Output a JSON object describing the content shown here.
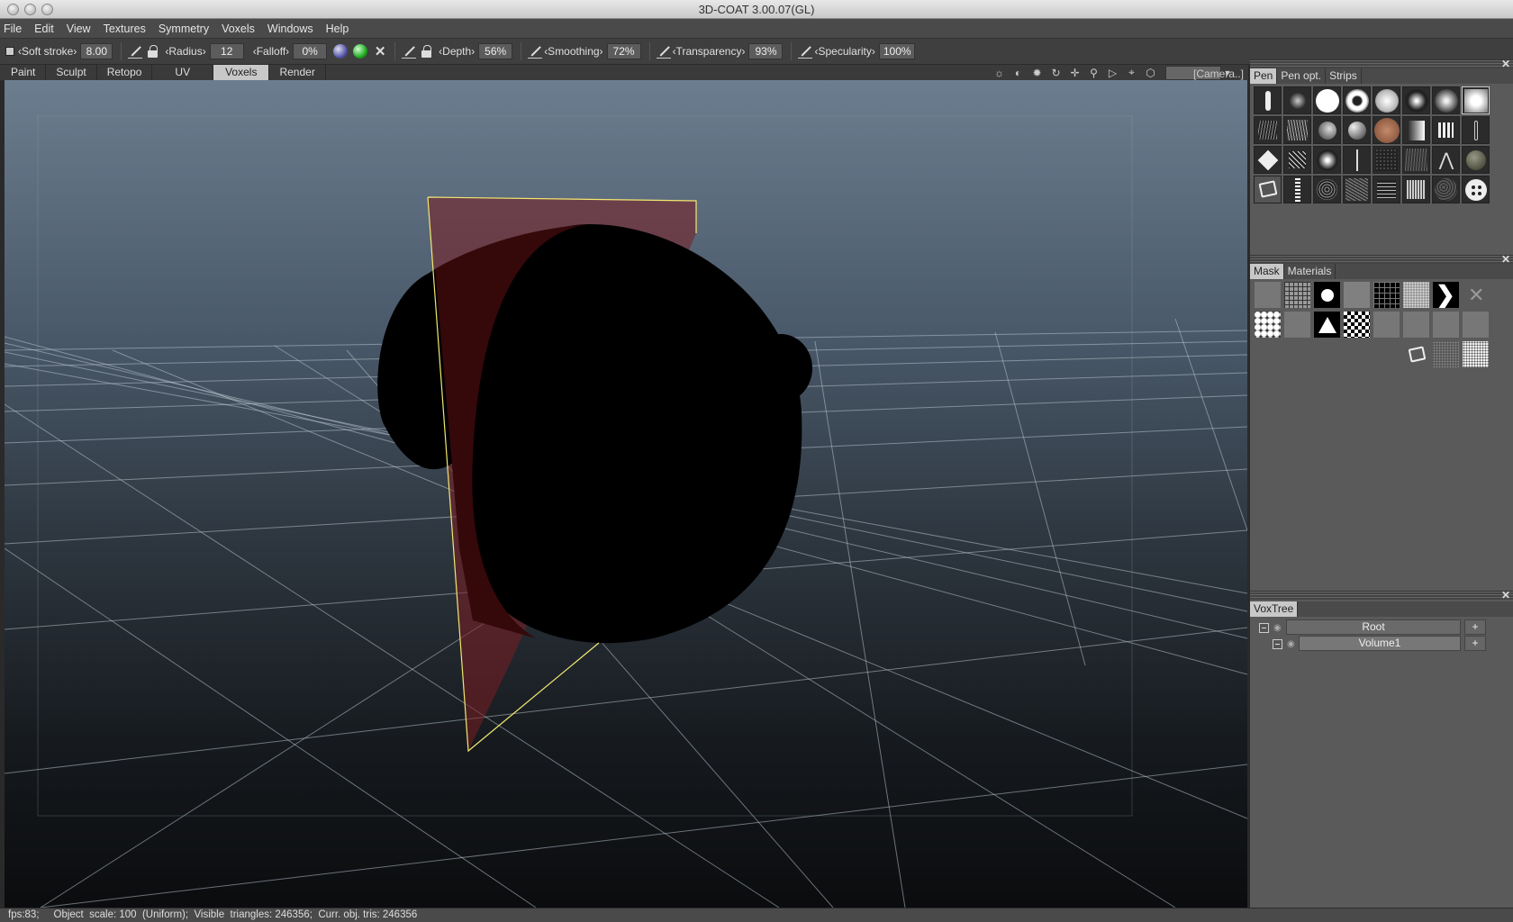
{
  "window": {
    "title": "3D-COAT 3.00.07(GL)"
  },
  "menu": [
    "File",
    "Edit",
    "View",
    "Textures",
    "Symmetry",
    "Voxels",
    "Windows",
    "Help"
  ],
  "toolbar": {
    "soft_stroke_label": "‹Soft  stroke›",
    "soft_stroke_value": "8.00",
    "radius_label": "‹Radius›",
    "radius_value": "12",
    "falloff_label": "‹Falloff›",
    "falloff_value": "0%",
    "depth_label": "‹Depth›",
    "depth_value": "56%",
    "smoothing_label": "‹Smoothing›",
    "smoothing_value": "72%",
    "transparency_label": "‹Transparency›",
    "transparency_value": "93%",
    "specularity_label": "‹Specularity›",
    "specularity_value": "100%"
  },
  "room_tabs": [
    "Paint",
    "Sculpt",
    "Retopo",
    "UV",
    "Voxels",
    "Render"
  ],
  "active_room": "Voxels",
  "camera_select": "[Camera..]",
  "nav_icons": [
    "light-icon",
    "contrast-icon",
    "sun-icon",
    "rotate-icon",
    "move-icon",
    "zoom-icon",
    "play-icon",
    "target-icon",
    "cube-icon"
  ],
  "right_panel": {
    "pen_tabs": [
      "Pen",
      "Pen  opt.",
      "Strips"
    ],
    "mask_tabs": [
      "Mask",
      "Materials"
    ],
    "voxtree_title": "VoxTree",
    "voxtree": [
      {
        "label": "Root",
        "add": "+"
      },
      {
        "label": "Volume1",
        "add": "+"
      }
    ]
  },
  "status": "fps:83;     Object  scale: 100  (Uniform);  Visible  triangles: 246356;  Curr. obj. tris: 246356",
  "colors": {
    "accent": "#c8c8c8",
    "clip_plane": "#7a1e22",
    "plane_outline": "#e8e070"
  }
}
